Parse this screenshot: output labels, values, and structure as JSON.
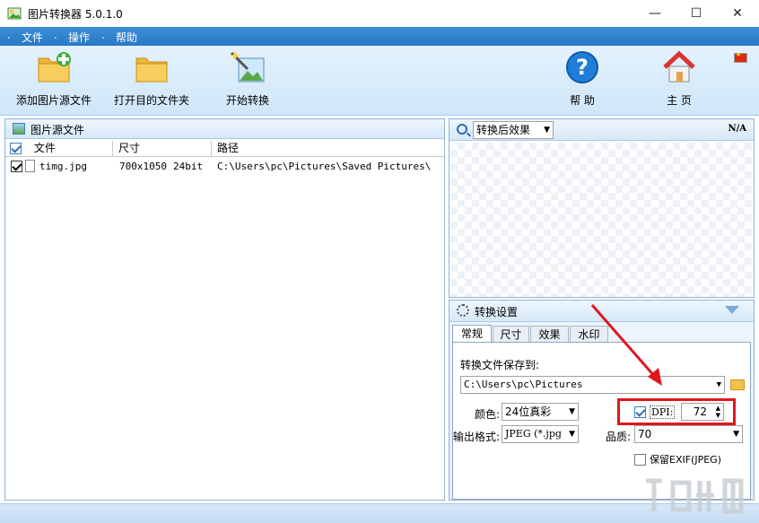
{
  "window": {
    "title": "图片转换器 5.0.1.0",
    "minimize": "—",
    "maximize": "☐",
    "close": "✕"
  },
  "menu": [
    {
      "label": "文件"
    },
    {
      "label": "操作"
    },
    {
      "label": "帮助"
    }
  ],
  "menu_dot": ".",
  "toolbar": {
    "add_source": "添加图片源文件",
    "open_dest": "打开目的文件夹",
    "start": "开始转换",
    "help": "帮 助",
    "home": "主 页"
  },
  "left_panel": {
    "title": "图片源文件",
    "columns": {
      "file": "文件",
      "size": "尺寸",
      "path": "路径"
    },
    "rows": [
      {
        "checked": true,
        "file": "timg.jpg",
        "dimensions": "700x1050",
        "depth": "24bit",
        "path": "C:\\Users\\pc\\Pictures\\Saved Pictures\\"
      }
    ]
  },
  "preview": {
    "dropdown": "转换后效果",
    "na": "N/A"
  },
  "settings": {
    "title": "转换设置",
    "tabs": [
      "常规",
      "尺寸",
      "效果",
      "水印"
    ],
    "save_to_label": "转换文件保存到:",
    "save_path": "C:\\Users\\pc\\Pictures",
    "color_label": "颜色:",
    "color_value": "24位真彩",
    "dpi_label": "DPI:",
    "dpi_value": "72",
    "format_label": "输出格式:",
    "format_value": "JPEG (*.jpg",
    "quality_label": "品质:",
    "quality_value": "70",
    "exif_label": "保留EXIF(JPEG)"
  },
  "colors": {
    "menubar": "#2a78c6",
    "annotation": "#e0161d"
  }
}
